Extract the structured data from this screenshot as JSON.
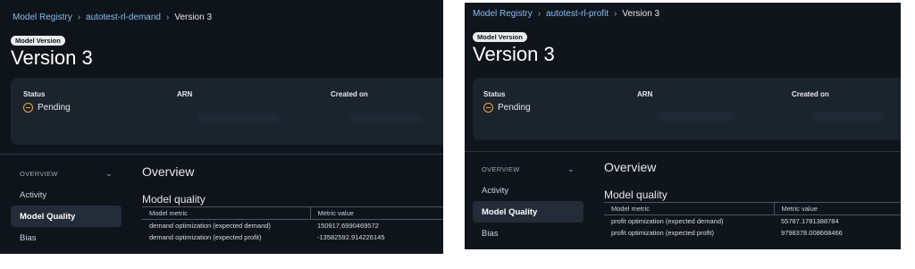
{
  "panels": [
    {
      "breadcrumb": {
        "root": "Model Registry",
        "group": "autotest-rl-demand",
        "current": "Version 3"
      },
      "badge": "Model Version",
      "title": "Version 3",
      "summary": {
        "status_label": "Status",
        "status_value": "Pending",
        "arn_label": "ARN",
        "created_label": "Created on"
      },
      "nav": {
        "overview": "OVERVIEW",
        "items": [
          "Activity",
          "Model Quality",
          "Bias"
        ],
        "active": "Model Quality"
      },
      "overview_title": "Overview",
      "model_quality_title": "Model quality",
      "table": {
        "headers": [
          "Model metric",
          "Metric value"
        ],
        "rows": [
          [
            "demand optimization (expected demand)",
            "150917.6990469572"
          ],
          [
            "demand optimization (expected profit)",
            "-13582592.914226145"
          ]
        ]
      }
    },
    {
      "breadcrumb": {
        "root": "Model Registry",
        "group": "autotest-rl-profit",
        "current": "Version 3"
      },
      "badge": "Model Version",
      "title": "Version 3",
      "summary": {
        "status_label": "Status",
        "status_value": "Pending",
        "arn_label": "ARN",
        "created_label": "Created on"
      },
      "nav": {
        "overview": "OVERVIEW",
        "items": [
          "Activity",
          "Model Quality",
          "Bias"
        ],
        "active": "Model Quality"
      },
      "overview_title": "Overview",
      "model_quality_title": "Model quality",
      "table": {
        "headers": [
          "Model metric",
          "Metric value"
        ],
        "rows": [
          [
            "profit optimization (expected demand)",
            "55787.1781388784"
          ],
          [
            "profit optimization (expected profit)",
            "9798378.008668466"
          ]
        ]
      }
    }
  ],
  "colors": {
    "background": "#0f141a",
    "link": "#89bdf3",
    "pending": "#f0a53a",
    "card": "#1b232d",
    "active_nav": "#232c38"
  },
  "icons": {
    "status": "pending-icon",
    "nav_toggle": "chevron-down-icon",
    "breadcrumb_separator": "chevron-right-icon"
  }
}
